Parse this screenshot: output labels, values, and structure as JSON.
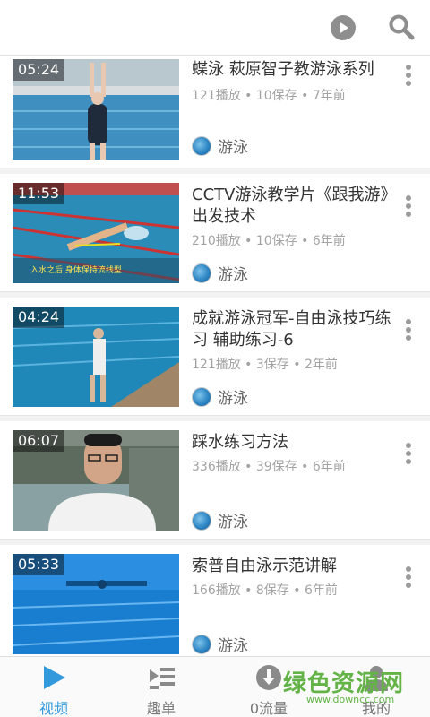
{
  "topbar": {
    "play_icon": "play-circle-icon",
    "search_icon": "search-icon"
  },
  "videos": [
    {
      "duration": "05:24",
      "title": "蝶泳 萩原智子教游泳系列",
      "meta": "121播放 • 10保存 • 7年前",
      "channel": "游泳"
    },
    {
      "duration": "11:53",
      "title": "CCTV游泳教学片《跟我游》出发技术",
      "meta": "210播放 • 10保存 • 6年前",
      "channel": "游泳"
    },
    {
      "duration": "04:24",
      "title": "成就游泳冠军-自由泳技巧练习 辅助练习-6",
      "meta": "121播放 • 3保存 • 2年前",
      "channel": "游泳"
    },
    {
      "duration": "06:07",
      "title": "踩水练习方法",
      "meta": "336播放 • 39保存 • 6年前",
      "channel": "游泳"
    },
    {
      "duration": "05:33",
      "title": "索普自由泳示范讲解",
      "meta": "166播放 • 8保存 • 6年前",
      "channel": "游泳"
    }
  ],
  "tabs": [
    {
      "label": "视频",
      "icon": "play-triangle-icon"
    },
    {
      "label": "趣单",
      "icon": "playlist-icon"
    },
    {
      "label": "0流量",
      "icon": "download-icon"
    },
    {
      "label": "我的",
      "icon": "profile-icon"
    }
  ],
  "watermark": {
    "main": "绿色资源网",
    "sub": "www.downcc.com"
  },
  "colors": {
    "accent": "#3399dd",
    "watermark": "#63b347"
  }
}
